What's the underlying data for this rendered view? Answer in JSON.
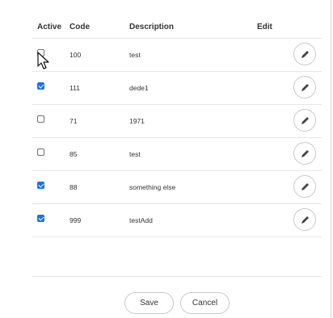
{
  "table": {
    "headers": {
      "active": "Active",
      "code": "Code",
      "description": "Description",
      "edit": "Edit"
    },
    "rows": [
      {
        "active": false,
        "code": "100",
        "description": "test"
      },
      {
        "active": true,
        "code": "111",
        "description": "dede1"
      },
      {
        "active": false,
        "code": "71",
        "description": "1971"
      },
      {
        "active": false,
        "code": "85",
        "description": "test"
      },
      {
        "active": true,
        "code": "88",
        "description": "something else"
      },
      {
        "active": true,
        "code": "999",
        "description": "testAdd"
      }
    ]
  },
  "icons": {
    "edit": "pencil-icon",
    "cursor": "mouse-pointer-icon"
  },
  "colors": {
    "checkbox_checked": "#1a73e8",
    "border": "#e6e6e6",
    "button_border": "#c9c9c9"
  },
  "footer": {
    "save_label": "Save",
    "cancel_label": "Cancel"
  }
}
